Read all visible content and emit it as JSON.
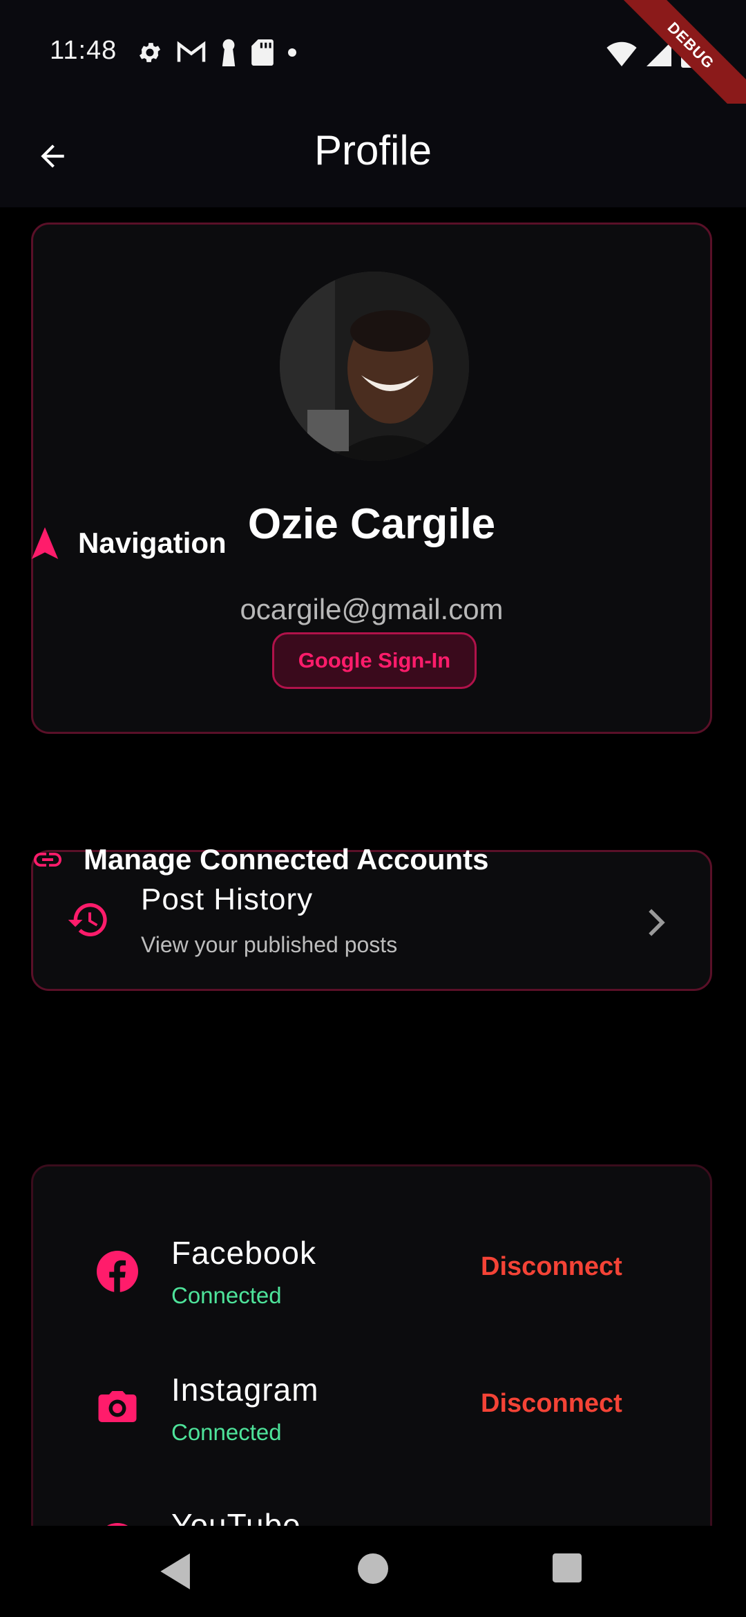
{
  "status_bar": {
    "time": "11:48",
    "debug_label": "DEBUG",
    "left_icons": [
      "settings-icon",
      "gmail-icon",
      "keyhole-icon",
      "sd-card-icon",
      "dot-icon"
    ],
    "right_icons": [
      "wifi-icon",
      "signal-icon",
      "battery-icon"
    ]
  },
  "app_bar": {
    "title": "Profile",
    "back_icon": "arrow-back-icon"
  },
  "profile": {
    "name": "Ozie Cargile",
    "email": "ocargile@gmail.com",
    "sign_in_method": "Google Sign-In"
  },
  "navigation_section": {
    "title": "Navigation",
    "items": [
      {
        "title": "Post History",
        "subtitle": "View your published posts",
        "icon": "history-icon"
      }
    ]
  },
  "accounts_section": {
    "title": "Manage Connected Accounts",
    "accounts": [
      {
        "name": "Facebook",
        "status": "Connected",
        "action": "Disconnect",
        "icon": "facebook-icon"
      },
      {
        "name": "Instagram",
        "status": "Connected",
        "action": "Disconnect",
        "icon": "camera-icon"
      },
      {
        "name": "YouTube",
        "icon": "youtube-icon"
      }
    ]
  },
  "colors": {
    "accent": "#ff1c6b",
    "card_border": "#5a1028",
    "connected": "#4ee39a",
    "disconnect": "#f44336",
    "background": "#000000"
  },
  "system_nav": [
    "back-triangle-icon",
    "home-circle-icon",
    "recents-square-icon"
  ]
}
